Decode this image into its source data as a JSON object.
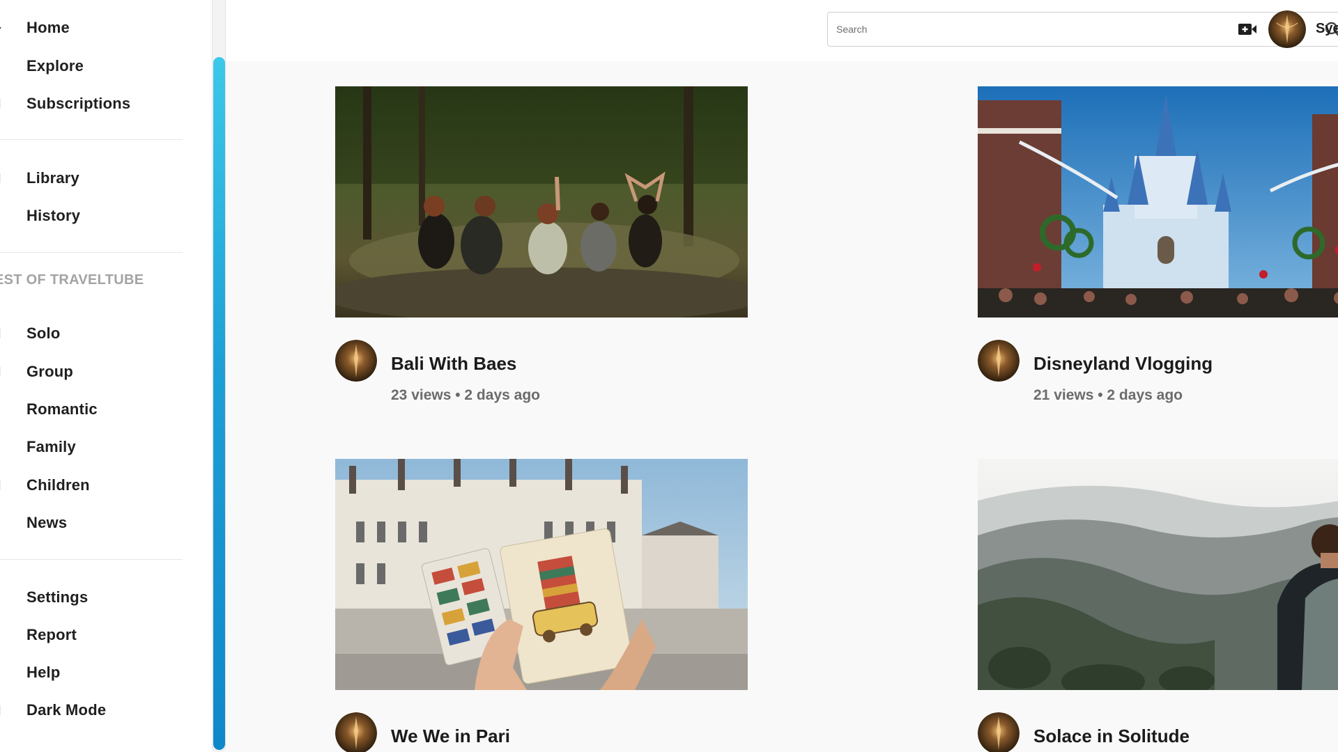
{
  "sidebar": {
    "items": [
      {
        "label": "Home",
        "icon": "home-icon"
      },
      {
        "label": "Explore",
        "icon": "explore-icon"
      },
      {
        "label": "Subscriptions",
        "icon": "subscriptions-icon"
      },
      {
        "label": "Library",
        "icon": "library-icon"
      },
      {
        "label": "History",
        "icon": "history-icon"
      },
      {
        "label": "Solo",
        "icon": "solo-icon"
      },
      {
        "label": "Group",
        "icon": "group-icon"
      },
      {
        "label": "Romantic",
        "icon": "romantic-icon"
      },
      {
        "label": "Family",
        "icon": "family-icon"
      },
      {
        "label": "Children",
        "icon": "children-icon"
      },
      {
        "label": "News",
        "icon": "news-icon"
      },
      {
        "label": "Settings",
        "icon": "settings-icon"
      },
      {
        "label": "Report",
        "icon": "report-icon"
      },
      {
        "label": "Help",
        "icon": "help-icon"
      },
      {
        "label": "Dark Mode",
        "icon": "dark-mode-icon"
      }
    ],
    "section_title": "EST OF TRAVELTUBE"
  },
  "header": {
    "search_placeholder": "Search",
    "search_icon": "search-icon",
    "create_icon": "create-video-icon",
    "user_name": "Sye"
  },
  "videos": [
    {
      "title": "Bali With Baes",
      "stats": "23 views • 2 days ago"
    },
    {
      "title": "Disneyland Vlogging",
      "stats": "21 views • 2 days ago"
    },
    {
      "title": "We We in Pari",
      "stats": ""
    },
    {
      "title": "Solace in Solitude",
      "stats": ""
    }
  ],
  "colors": {
    "scrollbar_top": "#3cc8e8",
    "scrollbar_bottom": "#0f88c9",
    "background": "#f9f9f9",
    "text_primary": "#1b1b1b",
    "text_secondary": "#6b6b6b",
    "section_title": "#a3a3a3"
  }
}
